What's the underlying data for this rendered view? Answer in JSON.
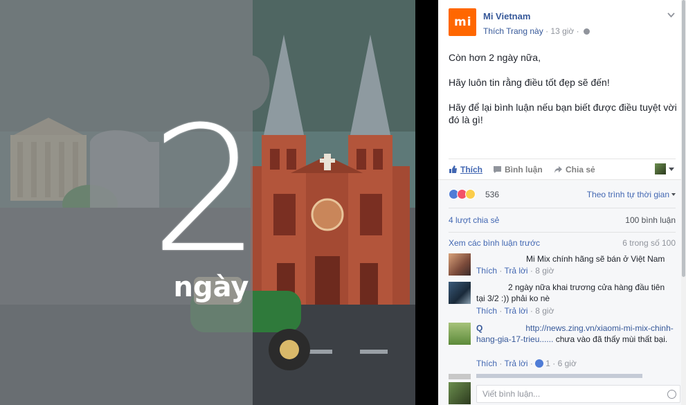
{
  "photo": {
    "caption_number": "2",
    "caption_text": "ngày"
  },
  "post": {
    "page_name": "Mi Vietnam",
    "logo_text": "mi",
    "like_page": "Thích Trang này",
    "time": "13 giờ",
    "paragraphs": [
      "Còn hơn 2 ngày nữa,",
      "Hãy luôn tin rằng điều tốt đẹp sẽ đến!",
      "Hãy để lại bình luận nếu bạn biết được điều tuyệt vời đó là gì!"
    ]
  },
  "actions": {
    "like": "Thích",
    "comment": "Bình luận",
    "share": "Chia sẻ"
  },
  "stats": {
    "reaction_count": "536",
    "sort_label": "Theo trình tự thời gian",
    "shares": "4 lượt chia sẻ",
    "comments_count": "100 bình luận",
    "view_previous": "Xem các bình luận trước",
    "page_count": "6 trong số 100"
  },
  "comments": [
    {
      "text": "Mi Mix chính hãng sẽ bán ở Việt Nam",
      "like_label": "Thích",
      "reply_label": "Trả lời",
      "time": "8 giờ"
    },
    {
      "text": "2 ngày nữa khai trương cửa hàng đầu tiên tại 3/2 :)) phải ko nè",
      "like_label": "Thích",
      "reply_label": "Trả lời",
      "time": "8 giờ"
    },
    {
      "name": "Q",
      "link": "http://news.zing.vn/xiaomi-mi-mix-chinh-hang-gia-17-trieu......",
      "text": "chưa vào đã thấy mùi thất bại.",
      "like_label": "Thích",
      "reply_label": "Trả lời",
      "likes": "1",
      "time": "6 giờ"
    }
  ],
  "composer": {
    "placeholder": "Viết bình luận..."
  },
  "colors": {
    "brand": "#ff6700",
    "link": "#4267b2",
    "panel_background": "#f6f7f9"
  }
}
